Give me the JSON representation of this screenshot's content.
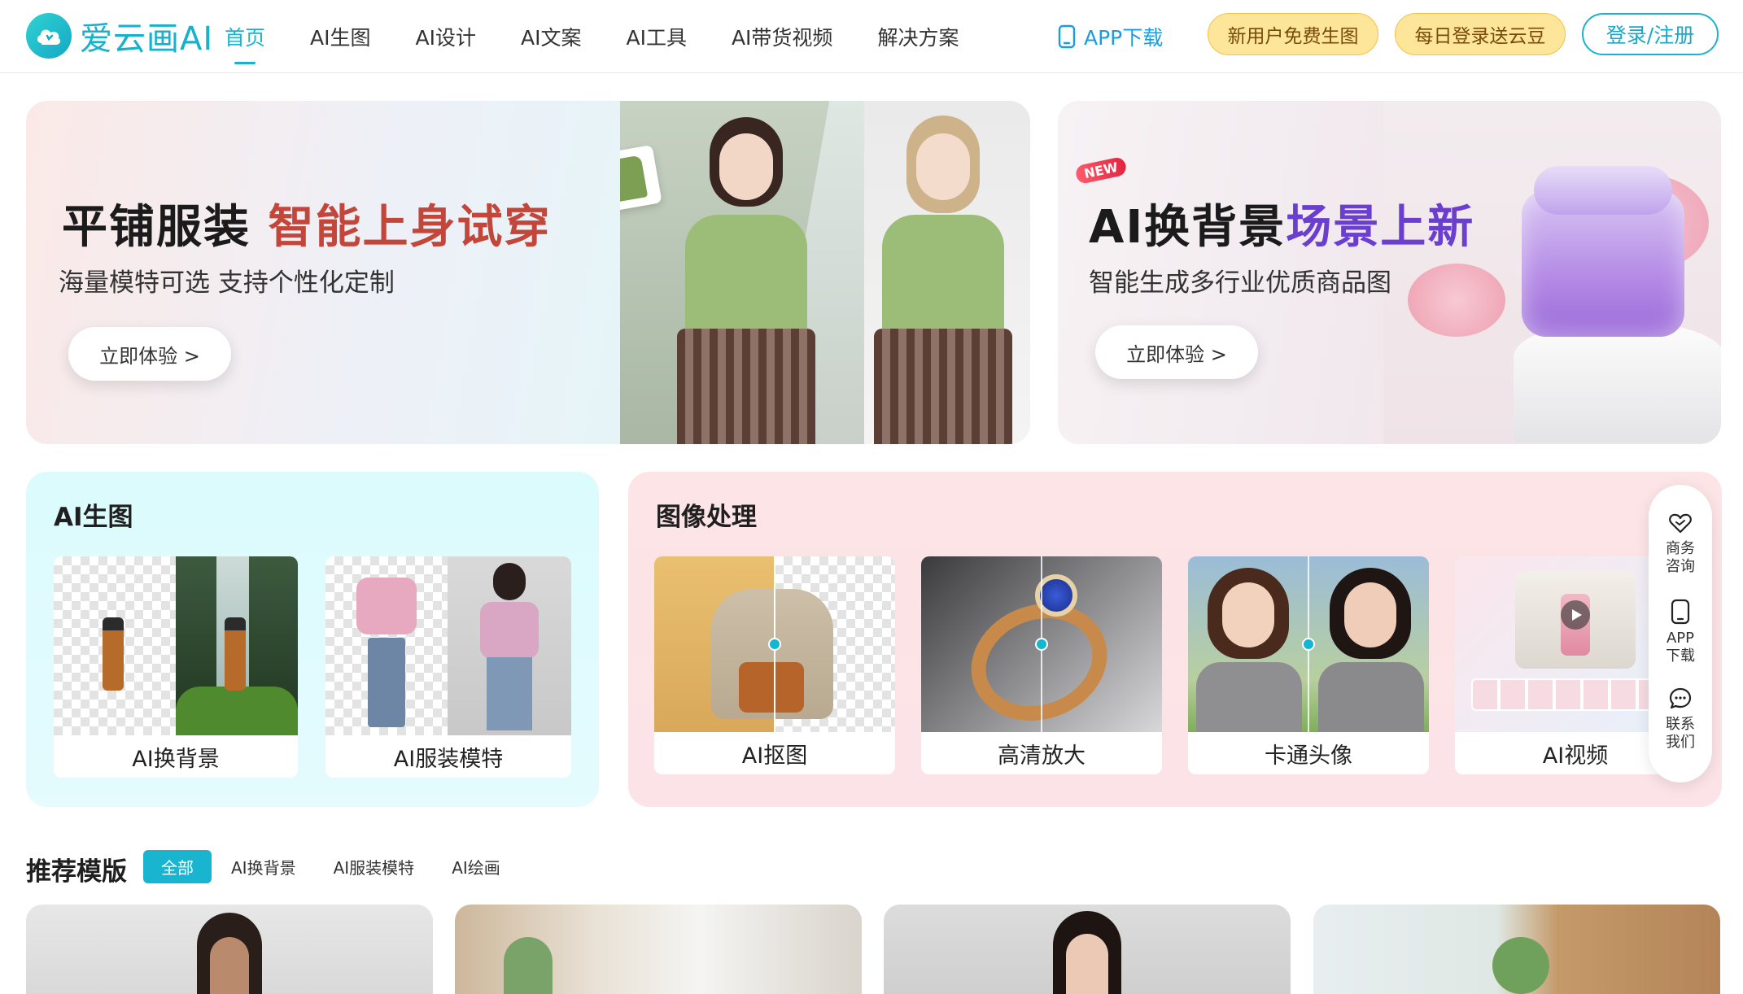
{
  "brand": {
    "name": "爱云画AI",
    "accent": "#19b3cf"
  },
  "nav": {
    "items": [
      {
        "label": "首页",
        "active": true
      },
      {
        "label": "AI生图",
        "active": false
      },
      {
        "label": "AI设计",
        "active": false
      },
      {
        "label": "AI文案",
        "active": false
      },
      {
        "label": "AI工具",
        "active": false
      },
      {
        "label": "AI带货视频",
        "active": false
      },
      {
        "label": "解决方案",
        "active": false
      }
    ],
    "app_download": "APP下载",
    "promo_new_user": "新用户免费生图",
    "promo_daily": "每日登录送云豆",
    "login": "登录/注册"
  },
  "banners": [
    {
      "title_main": "平铺服装 ",
      "title_highlight": "智能上身试穿",
      "subtitle": "海量模特可选 支持个性化定制",
      "button": "立即体验 >"
    },
    {
      "badge": "NEW",
      "title_main": "AI换背景",
      "title_highlight": "场景上新",
      "subtitle": "智能生成多行业优质商品图",
      "button": "立即体验 >"
    }
  ],
  "ai_gen": {
    "title": "AI生图",
    "tools": [
      {
        "label": "AI换背景"
      },
      {
        "label": "AI服装模特"
      }
    ]
  },
  "image_proc": {
    "title": "图像处理",
    "tools": [
      {
        "label": "AI抠图"
      },
      {
        "label": "高清放大"
      },
      {
        "label": "卡通头像"
      },
      {
        "label": "AI视频"
      }
    ]
  },
  "sidebar": {
    "items": [
      {
        "label": "商务咨询",
        "icon": "handshake-heart-icon"
      },
      {
        "label": "APP下载",
        "icon": "phone-icon"
      },
      {
        "label": "联系我们",
        "icon": "chat-bubble-icon"
      }
    ]
  },
  "recommended": {
    "title": "推荐模版",
    "filters": [
      {
        "label": "全部",
        "active": true
      },
      {
        "label": "AI换背景",
        "active": false
      },
      {
        "label": "AI服装模特",
        "active": false
      },
      {
        "label": "AI绘画",
        "active": false
      }
    ]
  }
}
